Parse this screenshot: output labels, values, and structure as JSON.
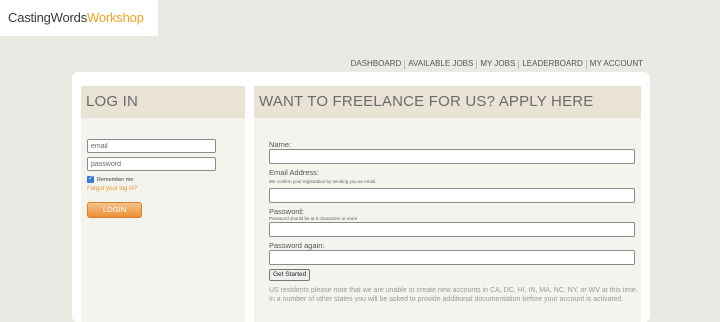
{
  "logo": {
    "part1": "CastingWords",
    "part2": "Workshop"
  },
  "nav": {
    "items": [
      {
        "label": "DASHBOARD"
      },
      {
        "label": "AVAILABLE JOBS"
      },
      {
        "label": "MY JOBS"
      },
      {
        "label": "LEADERBOARD"
      },
      {
        "label": "MY ACCOUNT"
      }
    ]
  },
  "login": {
    "heading": "LOG IN",
    "email_value": "email",
    "password_value": "password",
    "remember_label": "Remember me",
    "remember_checked": true,
    "forgot_label": "Forgot your log in?",
    "button_label": "LOGIN"
  },
  "apply": {
    "heading": "WANT TO FREELANCE FOR US? APPLY HERE",
    "name_label": "Name:",
    "email_label": "Email Address:",
    "email_note": "We confirm your registration by sending you an email.",
    "password_label": "Password:",
    "password_note": "Password should be at 6 characters or more",
    "password_again_label": "Password again:",
    "submit_label": "Get Started",
    "notice": "US residents please note that we are unable to create new accounts in CA, DC, HI, IN, MA, NC, NY, or WV at this time. In a number of other states you will be asked to provide additional documentation before your account is activated."
  },
  "colors": {
    "accent": "#f0a31c",
    "button": "#ee9036",
    "background": "#ebe9e3",
    "panel_header": "#e8e3d5"
  }
}
